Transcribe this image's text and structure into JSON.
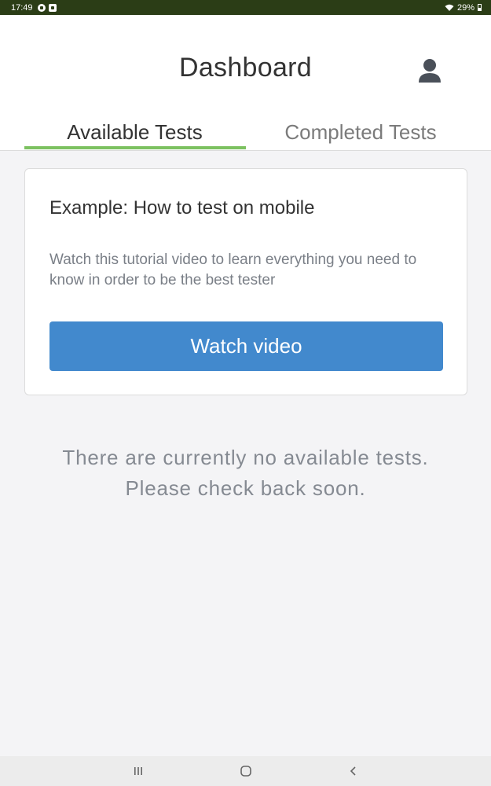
{
  "status_bar": {
    "time": "17:49",
    "battery": "29%",
    "icons": [
      "app-notification-icon",
      "app-notification-icon-2",
      "wifi-icon",
      "battery-icon"
    ]
  },
  "header": {
    "title": "Dashboard",
    "profile_icon": "user-icon"
  },
  "tabs": [
    {
      "label": "Available Tests",
      "active": true
    },
    {
      "label": "Completed Tests",
      "active": false
    }
  ],
  "card": {
    "title": "Example: How to test on mobile",
    "description": "Watch this tutorial video to learn everything you need to know in order to be the best tester",
    "button_label": "Watch video"
  },
  "empty_state": {
    "line1": "There are currently no available tests.",
    "line2": "Please check back soon."
  },
  "nav_bar": {
    "buttons": [
      "recent-apps-icon",
      "home-icon",
      "back-icon"
    ]
  },
  "colors": {
    "status_bar_bg": "#2b3d16",
    "tab_underline": "#7cc160",
    "button_bg": "#4289cd",
    "page_bg": "#f4f4f6"
  }
}
